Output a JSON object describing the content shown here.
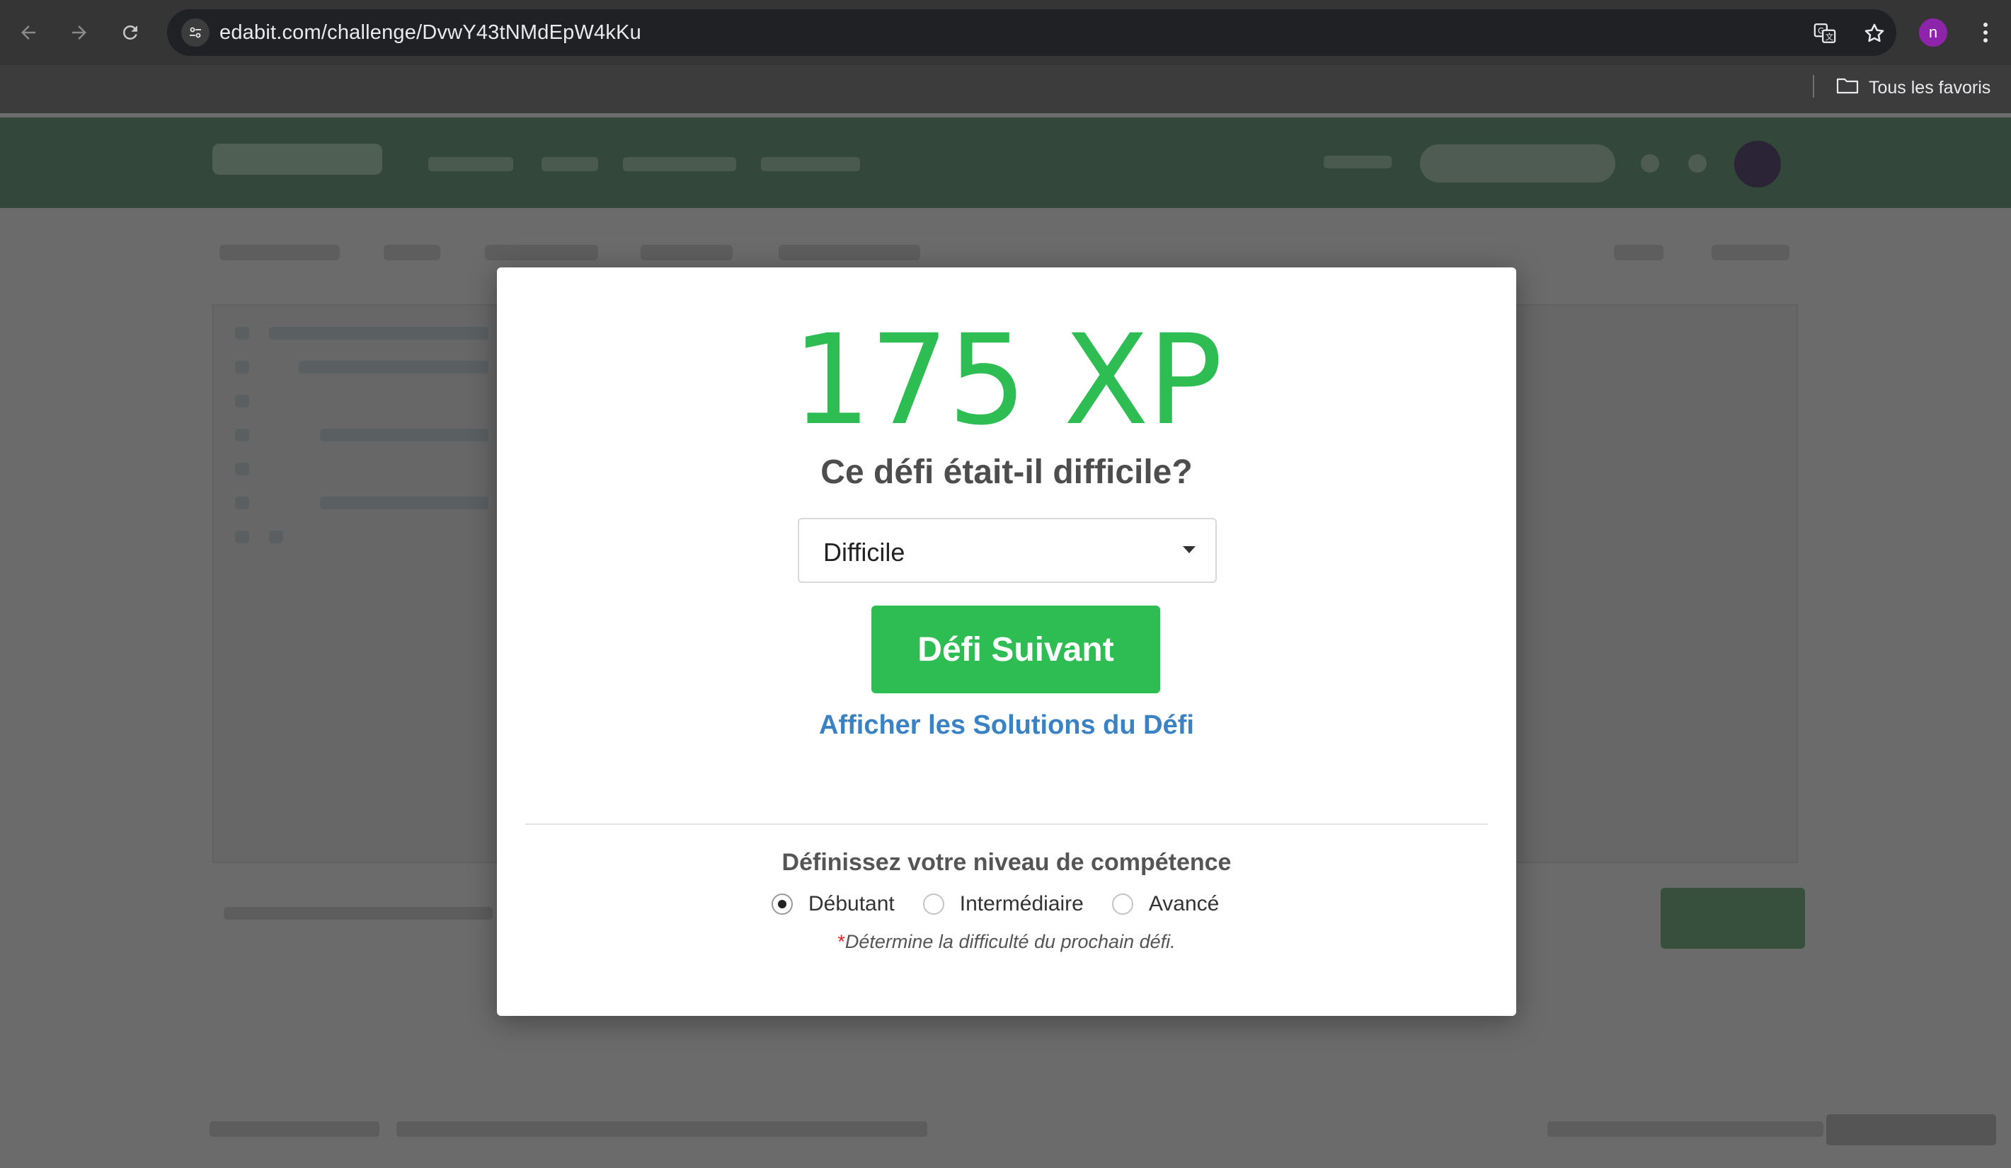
{
  "browser": {
    "url": "edabit.com/challenge/DvwY43tNMdEpW4kKu",
    "profile_initial": "n",
    "bookmarks_folder_label": "Tous les favoris",
    "icons": {
      "back": "back-arrow-icon",
      "forward": "forward-arrow-icon",
      "reload": "reload-icon",
      "site_info": "tune-icon",
      "translate": "translate-icon",
      "bookmark": "star-icon",
      "menu": "kebab-menu-icon",
      "folder": "folder-icon"
    }
  },
  "modal": {
    "xp": "175 XP",
    "question": "Ce défi était-il difficile?",
    "difficulty_select": {
      "selected": "Difficile"
    },
    "next_button_label": "Défi Suivant",
    "solutions_link": "Afficher les Solutions du Défi",
    "skill_title": "Définissez votre niveau de compétence",
    "skill_levels": [
      {
        "label": "Débutant",
        "checked": true
      },
      {
        "label": "Intermédiaire",
        "checked": false
      },
      {
        "label": "Avancé",
        "checked": false
      }
    ],
    "note_asterisk": "*",
    "note_text": "Détermine la difficulté du prochain défi."
  },
  "colors": {
    "accent_green": "#2ebd52",
    "link_blue": "#3b82c4",
    "overlay_header_green": "#33483a",
    "profile_purple": "#8e24aa"
  }
}
